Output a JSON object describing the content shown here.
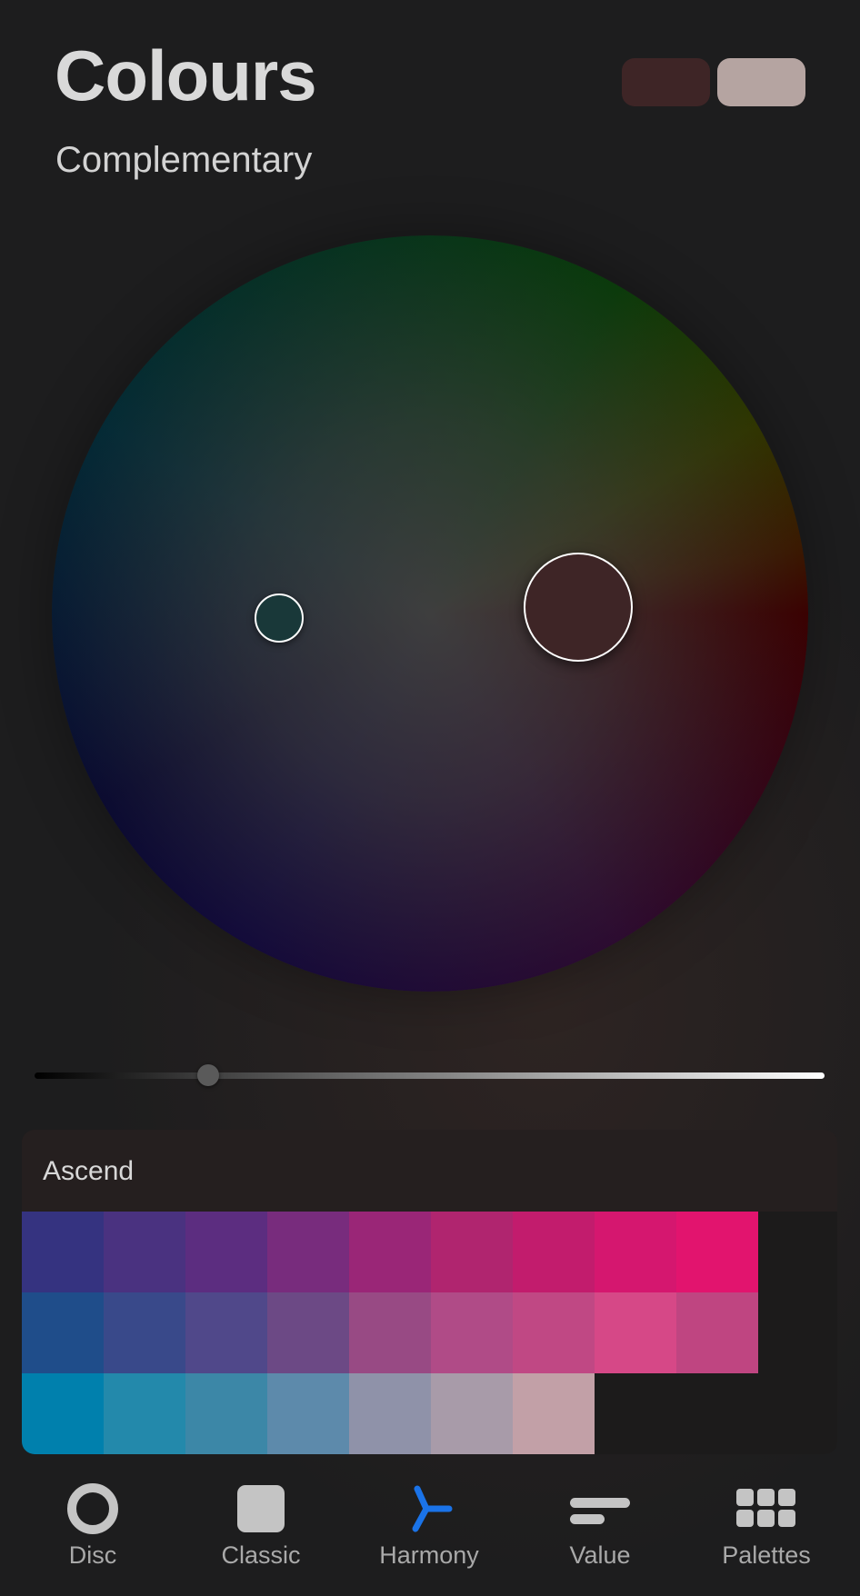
{
  "header": {
    "title": "Colours",
    "mode": "Complementary"
  },
  "current_colours": {
    "primary": "#3e2526",
    "secondary": "#b5a4a1"
  },
  "harmony": {
    "picker_primary_color": "#3e2526",
    "picker_complement_color": "#193839"
  },
  "brightness_slider": {
    "value": 0.22
  },
  "palette": {
    "name": "Ascend",
    "rows": [
      [
        "#353380",
        "#4a3280",
        "#5c2d80",
        "#782c7d",
        "#9a2677",
        "#b0256f",
        "#c21c6d",
        "#d5176f",
        "#e2146e"
      ],
      [
        "#1f4d8a",
        "#39498a",
        "#50488a",
        "#6c4985",
        "#984a84",
        "#b04b87",
        "#c04884",
        "#d64887",
        "#bf4581"
      ],
      [
        "#0080ad",
        "#2389ab",
        "#3c87a7",
        "#5d8aab",
        "#8f92a9",
        "#a89ba9",
        "#c2a0a7"
      ]
    ]
  },
  "tabs": [
    {
      "label": "Disc",
      "icon": "disc-icon"
    },
    {
      "label": "Classic",
      "icon": "square-icon"
    },
    {
      "label": "Harmony",
      "icon": "harmony-icon",
      "active": true
    },
    {
      "label": "Value",
      "icon": "value-bars-icon"
    },
    {
      "label": "Palettes",
      "icon": "grid-icon"
    }
  ],
  "accent_color": "#1a73e8"
}
